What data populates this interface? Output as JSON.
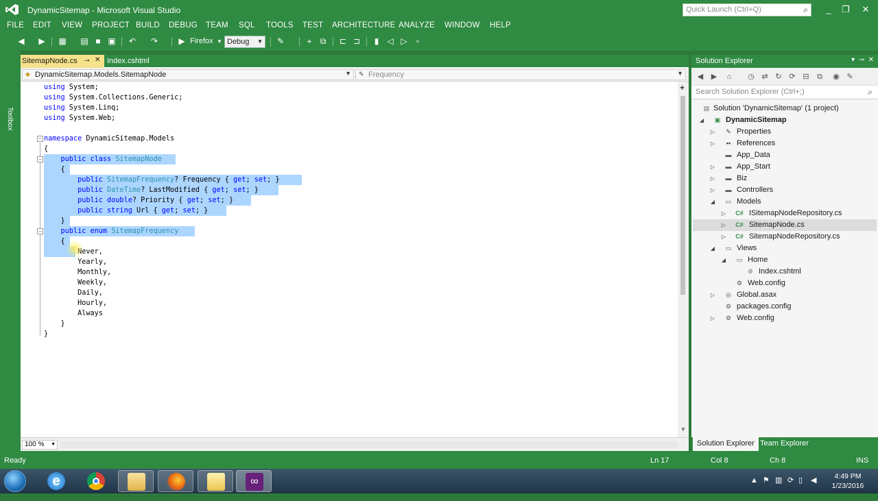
{
  "window": {
    "title": "DynamicSitemap - Microsoft Visual Studio",
    "quick_launch_placeholder": "Quick Launch (Ctrl+Q)"
  },
  "menu": [
    "FILE",
    "EDIT",
    "VIEW",
    "PROJECT",
    "BUILD",
    "DEBUG",
    "TEAM",
    "SQL",
    "TOOLS",
    "TEST",
    "ARCHITECTURE",
    "ANALYZE",
    "WINDOW",
    "HELP"
  ],
  "toolbar": {
    "run_target": "Firefox",
    "configuration": "Debug"
  },
  "toolbox_label": "Toolbox",
  "editor": {
    "tabs": [
      {
        "label": "SitemapNode.cs",
        "active": true
      },
      {
        "label": "Index.cshtml",
        "active": false
      }
    ],
    "nav_type": "DynamicSitemap.Models.SitemapNode",
    "nav_member": "Frequency",
    "zoom": "100 %",
    "lines": [
      "using System;",
      "using System.Collections.Generic;",
      "using System.Linq;",
      "using System.Web;",
      "",
      "namespace DynamicSitemap.Models",
      "{",
      "    public class SitemapNode",
      "    {",
      "        public SitemapFrequency? Frequency { get; set; }",
      "        public DateTime? LastModified { get; set; }",
      "        public double? Priority { get; set; }",
      "        public string Url { get; set; }",
      "    }",
      "    public enum SitemapFrequency",
      "    {",
      "        Never,",
      "        Yearly,",
      "        Monthly,",
      "        Weekly,",
      "        Daily,",
      "        Hourly,",
      "        Always",
      "    }",
      "}"
    ]
  },
  "solution_explorer": {
    "title": "Solution Explorer",
    "search_placeholder": "Search Solution Explorer (Ctrl+;)",
    "tree": [
      {
        "label": "Solution 'DynamicSitemap' (1 project)",
        "icon": "solution-icon",
        "bold": false
      },
      {
        "label": "DynamicSitemap",
        "icon": "project-icon",
        "bold": true
      },
      {
        "label": "Properties",
        "icon": "wrench-icon"
      },
      {
        "label": "References",
        "icon": "references-icon"
      },
      {
        "label": "App_Data",
        "icon": "folder-icon"
      },
      {
        "label": "App_Start",
        "icon": "folder-icon"
      },
      {
        "label": "Biz",
        "icon": "folder-icon"
      },
      {
        "label": "Controllers",
        "icon": "folder-icon"
      },
      {
        "label": "Models",
        "icon": "folder-open-icon"
      },
      {
        "label": "ISitemapNodeRepository.cs",
        "icon": "csharp-file-icon"
      },
      {
        "label": "SitemapNode.cs",
        "icon": "csharp-file-icon"
      },
      {
        "label": "SitemapNodeRepository.cs",
        "icon": "csharp-file-icon"
      },
      {
        "label": "Views",
        "icon": "folder-open-icon"
      },
      {
        "label": "Home",
        "icon": "folder-open-icon"
      },
      {
        "label": "Index.cshtml",
        "icon": "razor-file-icon"
      },
      {
        "label": "Web.config",
        "icon": "config-file-icon"
      },
      {
        "label": "Global.asax",
        "icon": "global-file-icon"
      },
      {
        "label": "packages.config",
        "icon": "config-file-icon"
      },
      {
        "label": "Web.config",
        "icon": "config-file-icon"
      }
    ],
    "tabs": [
      "Solution Explorer",
      "Team Explorer"
    ]
  },
  "status": {
    "message": "Ready",
    "line": "Ln 17",
    "col": "Col 8",
    "ch": "Ch 8",
    "mode": "INS"
  },
  "taskbar": {
    "time": "4:49 PM",
    "date": "1/23/2016"
  },
  "colors": {
    "theme_green": "#2f8a42",
    "keyword": "#0000ff",
    "type": "#2b91af",
    "selection": "#add6ff"
  }
}
